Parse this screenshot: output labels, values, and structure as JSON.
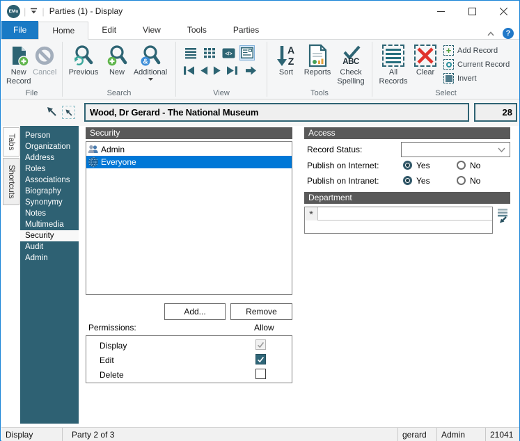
{
  "titlebar": {
    "logo": "EMu",
    "title": "Parties (1) - Display"
  },
  "tabrow": {
    "tabs": [
      "File",
      "Home",
      "Edit",
      "View",
      "Tools",
      "Parties"
    ],
    "active_tab": "Home",
    "help_glyph": "?"
  },
  "ribbon": {
    "file_group": "File",
    "new_record": "New Record",
    "cancel": "Cancel",
    "search_group": "Search",
    "previous": "Previous",
    "new": "New",
    "additional": "Additional",
    "view_group": "View",
    "tools_group": "Tools",
    "sort": "Sort",
    "reports": "Reports",
    "check_spelling": "Check Spelling",
    "select_group": "Select",
    "all_records": "All Records",
    "clear": "Clear",
    "add_record": "Add Record",
    "current_record": "Current Record",
    "invert": "Invert",
    "glyphs": {
      "sort_a": "A",
      "sort_z": "Z",
      "spell_abc": "ABC",
      "xml": "</>",
      "ampersand": "&"
    }
  },
  "record_bar": {
    "summary": "Wood, Dr Gerard - The National Museum",
    "record_count": "28"
  },
  "sidebar": {
    "strips": [
      "Tabs",
      "Shortcuts"
    ],
    "tabs": [
      "Person",
      "Organization",
      "Address",
      "Roles",
      "Associations",
      "Biography",
      "Synonymy",
      "Notes",
      "Multimedia",
      "Security",
      "Audit",
      "Admin"
    ],
    "active_tab": "Security"
  },
  "security_panel": {
    "header": "Security",
    "groups": [
      {
        "name": "Admin",
        "icon": "users-icon"
      },
      {
        "name": "Everyone",
        "icon": "globe-icon",
        "selected": true
      }
    ],
    "add_button": "Add...",
    "remove_button": "Remove",
    "permissions_label": "Permissions:",
    "allow_label": "Allow",
    "permissions": [
      {
        "name": "Display",
        "allow": true,
        "disabled": true
      },
      {
        "name": "Edit",
        "allow": true,
        "disabled": false
      },
      {
        "name": "Delete",
        "allow": false,
        "disabled": false
      }
    ]
  },
  "access_panel": {
    "header": "Access",
    "record_status_label": "Record Status:",
    "record_status_value": "",
    "publish_internet_label": "Publish on Internet:",
    "publish_internet_value": "Yes",
    "publish_intranet_label": "Publish on Intranet:",
    "publish_intranet_value": "Yes",
    "yes_label": "Yes",
    "no_label": "No"
  },
  "department_panel": {
    "header": "Department",
    "row_marker": "*"
  },
  "status_bar": {
    "mode": "Display",
    "record_position": "Party 2 of 3",
    "user": "gerard",
    "group": "Admin",
    "record_id": "21041"
  },
  "colors": {
    "accent_blue": "#0078d7",
    "file_tab_blue": "#1a7ac5",
    "icon_teal": "#2d6473",
    "panel_teal": "#2e6173",
    "header_gray": "#595959",
    "selection_blue": "#0078d7",
    "green": "#5fb54b",
    "red": "#e0332c",
    "badge_blue": "#3e8ed8"
  }
}
